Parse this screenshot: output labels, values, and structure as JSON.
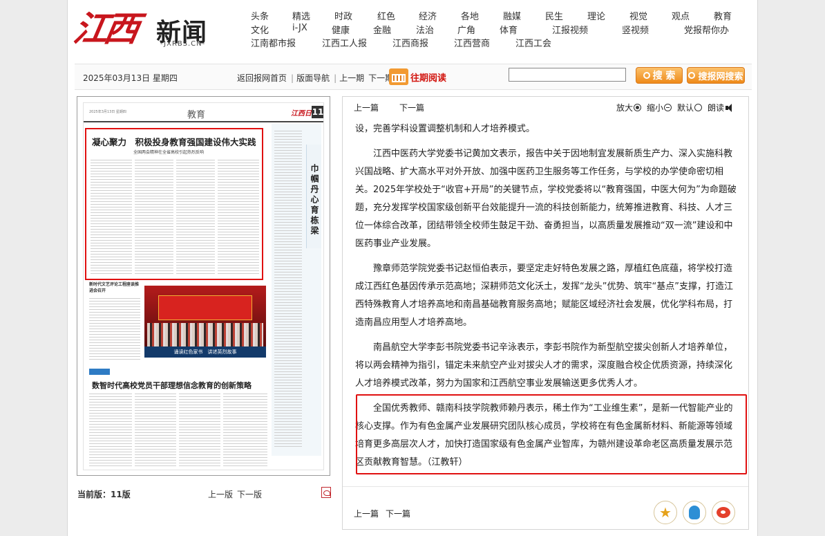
{
  "header": {
    "logo_text": "江西",
    "logo_news": "新闻",
    "logo_url": "-JXRBS.CN-"
  },
  "nav": {
    "row1": [
      "头条",
      "精选",
      "时政",
      "红色",
      "经济",
      "各地",
      "融媒",
      "民生",
      "理论",
      "视觉",
      "观点",
      "教育"
    ],
    "row2": [
      "文化",
      "i-JX",
      "健康",
      "金融",
      "法治",
      "广角",
      "体育",
      "江报视频",
      "竖视频",
      "党报帮你办"
    ],
    "row3": [
      "江南都市报",
      "江西工人报",
      "江西商报",
      "江西营商",
      "江西工会"
    ]
  },
  "toolbar": {
    "date": "2025年03月13日 星期四",
    "home": "返回报网首页",
    "layout_nav": "版面导航",
    "prev_issue": "上一期",
    "next_issue": "下一期",
    "past_reading": "往期阅读",
    "search_value": "",
    "search_button": "搜 索",
    "site_search_button": "搜报网搜索"
  },
  "newspaper": {
    "date_line": "2025年3月13日 星期四",
    "section": "教育",
    "masthead": "江西日报",
    "page_number": "11",
    "headline": "凝心聚力　积极投身教育强国建设伟大实践",
    "subhead": "全国两会精神在全省高校引起热烈反响",
    "side_title": "巾帼丹心育栋梁",
    "small_headline": "新时代文艺评论工程座谈推进会召开",
    "photo_caption": "诵读红色家书　讲述英烈故事",
    "bottom_headline": "数智时代高校党员干部理想信念教育的创新策略"
  },
  "page_info": {
    "current_label": "当前版：",
    "current_value": "11版",
    "prev_page": "上一版",
    "next_page": "下一版"
  },
  "article_controls": {
    "prev": "上一篇",
    "next": "下一篇",
    "zoom_in": "放大",
    "zoom_out": "缩小",
    "default": "默认",
    "read": "朗读"
  },
  "article": {
    "paragraphs": [
      "设，完善学科设置调整机制和人才培养模式。",
      "江西中医药大学党委书记黄加文表示，报告中关于因地制宜发展新质生产力、深入实施科教兴国战略、扩大高水平对外开放、加强中医药卫生服务等工作任务，与学校的办学使命密切相关。2025年学校处于“收官+开局”的关键节点，学校党委将以“教育强国，中医大何为”为命题破题，充分发挥学校国家级创新平台效能提升一流的科技创新能力，统筹推进教育、科技、人才三位一体综合改革，团结带领全校师生鼓足干劲、奋勇担当，以高质量发展推动“双一流”建设和中医药事业产业发展。",
      "豫章师范学院党委书记赵恒伯表示，要坚定走好特色发展之路，厚植红色底蕴，将学校打造成江西红色基因传承示范高地；深耕师范文化沃土，发挥“龙头”优势、筑牢“基点”支撑，打造江西特殊教育人才培养高地和南昌基础教育服务高地；赋能区域经济社会发展，优化学科布局，打造南昌应用型人才培养高地。",
      "南昌航空大学李彭书院党委书记辛泳表示，李彭书院作为新型航空拔尖创新人才培养单位，将以两会精神为指引，锚定未来航空产业对拔尖人才的需求，深度融合校企优质资源，持续深化人才培养模式改革，努力为国家和江西航空事业发展输送更多优秀人才。",
      "全国优秀教师、赣南科技学院教师赖丹表示，稀土作为“工业维生素”，是新一代智能产业的核心支撑。作为有色金属产业发展研究团队核心成员，学校将在有色金属新材料、新能源等领域培育更多高层次人才，加快打造国家级有色金属产业智库，为赣州建设革命老区高质量发展示范区贡献教育智慧。（江教轩）"
    ]
  },
  "share": {
    "icons": [
      "favorite-icon",
      "qq-icon",
      "weibo-icon"
    ],
    "colors": {
      "accent": "#e5a21b",
      "qq": "#2d8fd5",
      "weibo": "#e4402b",
      "highlight": "#e01010"
    }
  }
}
